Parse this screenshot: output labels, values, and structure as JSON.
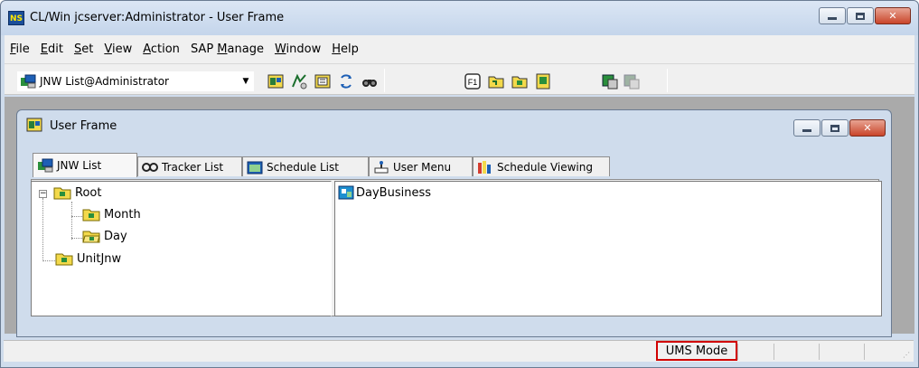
{
  "window": {
    "app_icon_text": "NS",
    "title": "CL/Win jcserver:Administrator - User Frame"
  },
  "menu": [
    {
      "label": "File",
      "accel": "F",
      "rest": "ile"
    },
    {
      "label": "Edit",
      "accel": "E",
      "rest": "dit"
    },
    {
      "label": "Set",
      "accel": "S",
      "rest": "et"
    },
    {
      "label": "View",
      "accel": "V",
      "rest": "iew"
    },
    {
      "label": "Action",
      "accel": "A",
      "rest": "ction"
    },
    {
      "label": "SAP Manage",
      "prefix": "SAP ",
      "accel": "M",
      "rest": "anage"
    },
    {
      "label": "Window",
      "accel": "W",
      "rest": "indow"
    },
    {
      "label": "Help",
      "accel": "H",
      "rest": "elp"
    }
  ],
  "toolbar": {
    "combo_value": "JNW List@Administrator",
    "buttons": [
      "jnw-frame-icon",
      "tracker-icon",
      "schedule-icon",
      "refresh-icon",
      "find-icon",
      "f1-help-icon",
      "open-folder-icon",
      "network-folder-icon",
      "job-icon",
      "log-icon",
      "disabled-log-icon"
    ]
  },
  "child": {
    "title": "User Frame"
  },
  "tabs": [
    {
      "label": "JNW List",
      "icon": "jnw-list-icon",
      "active": true
    },
    {
      "label": "Tracker List",
      "icon": "tracker-icon",
      "active": false
    },
    {
      "label": "Schedule List",
      "icon": "schedule-icon",
      "active": false
    },
    {
      "label": "User Menu",
      "icon": "user-menu-icon",
      "active": false
    },
    {
      "label": "Schedule Viewing",
      "icon": "schedule-viewing-icon",
      "active": false
    }
  ],
  "tree": {
    "root": "Root",
    "month": "Month",
    "day": "Day",
    "unitjnw": "UnitJnw"
  },
  "list": {
    "item": "DayBusiness"
  },
  "status": {
    "mode": "UMS Mode"
  }
}
